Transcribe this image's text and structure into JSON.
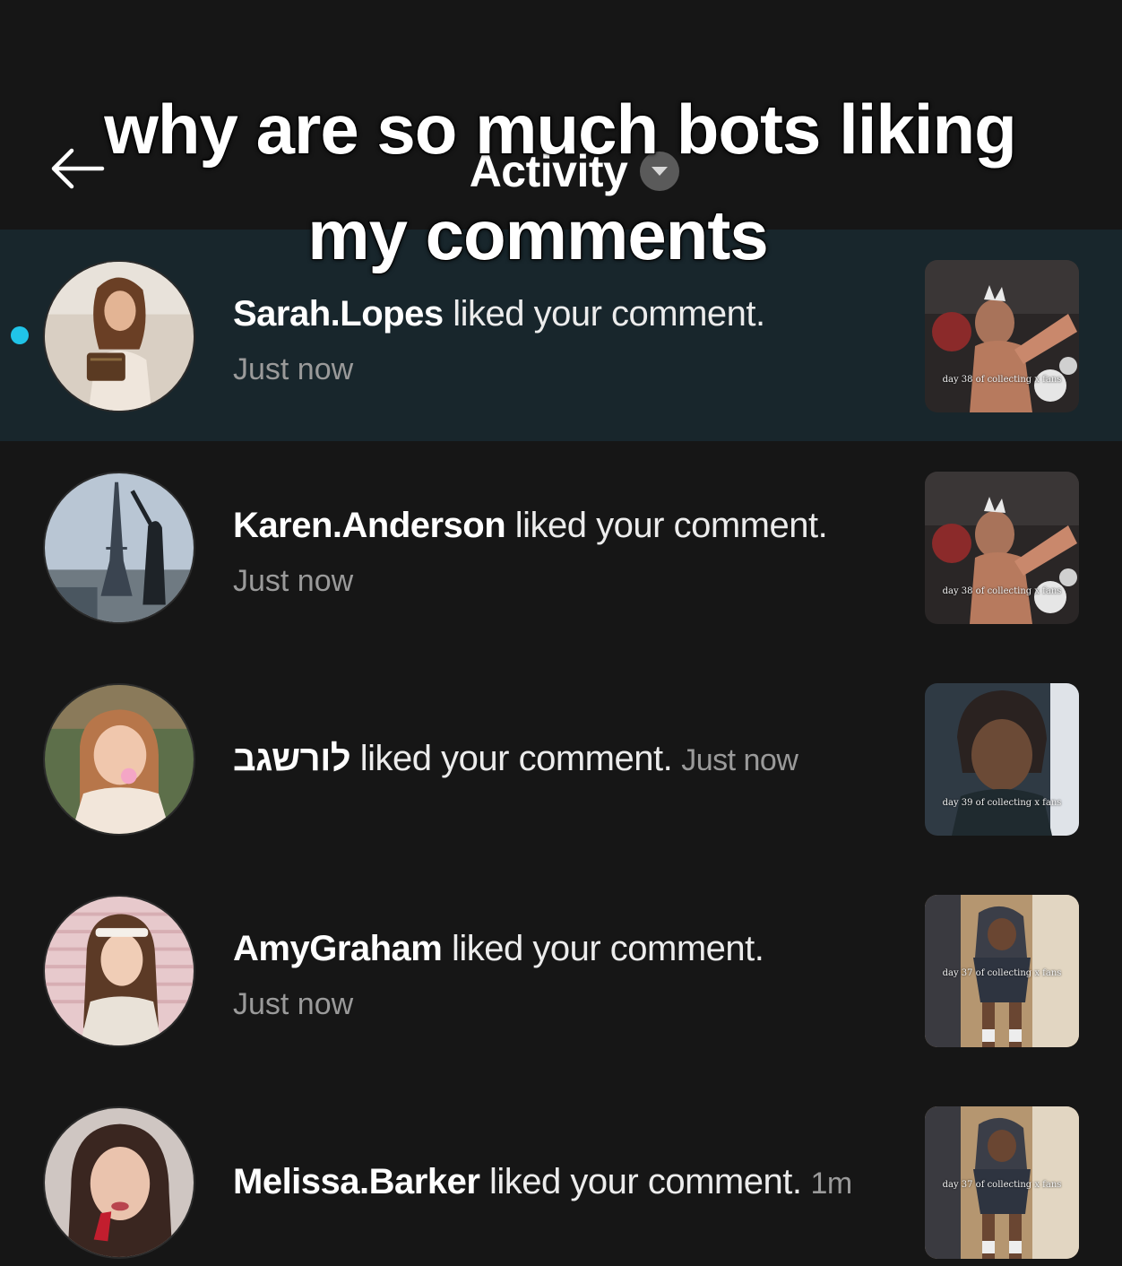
{
  "overlay_caption": {
    "line1": "why are so much bots liking",
    "line2": "my comments"
  },
  "header": {
    "title": "Activity",
    "back_icon": "arrow-left-icon",
    "dropdown_icon": "chevron-down-icon"
  },
  "colors": {
    "background": "#161616",
    "unread_row": "#18262c",
    "unread_dot": "#20c4e8",
    "secondary_text": "#9a9a9a"
  },
  "notifications": [
    {
      "username": "Sarah.Lopes",
      "action": " liked your comment.",
      "time": "Just now",
      "unread": true,
      "thumb_caption": "day 38 of collecting x fans"
    },
    {
      "username": "Karen.Anderson",
      "action": " liked your comment.",
      "time": "Just now",
      "unread": false,
      "thumb_caption": "day 38 of collecting x fans"
    },
    {
      "username": "לורשגב",
      "action": " liked your comment.",
      "time": "Just now",
      "unread": false,
      "thumb_caption": "day 39 of collecting x fans"
    },
    {
      "username": "AmyGraham",
      "action": " liked your comment.",
      "time": "Just now",
      "unread": false,
      "thumb_caption": "day 37 of collecting x fans"
    },
    {
      "username": "Melissa.Barker",
      "action": " liked your comment.",
      "time": "1m",
      "unread": false,
      "thumb_caption": "day 37 of collecting x fans"
    }
  ]
}
